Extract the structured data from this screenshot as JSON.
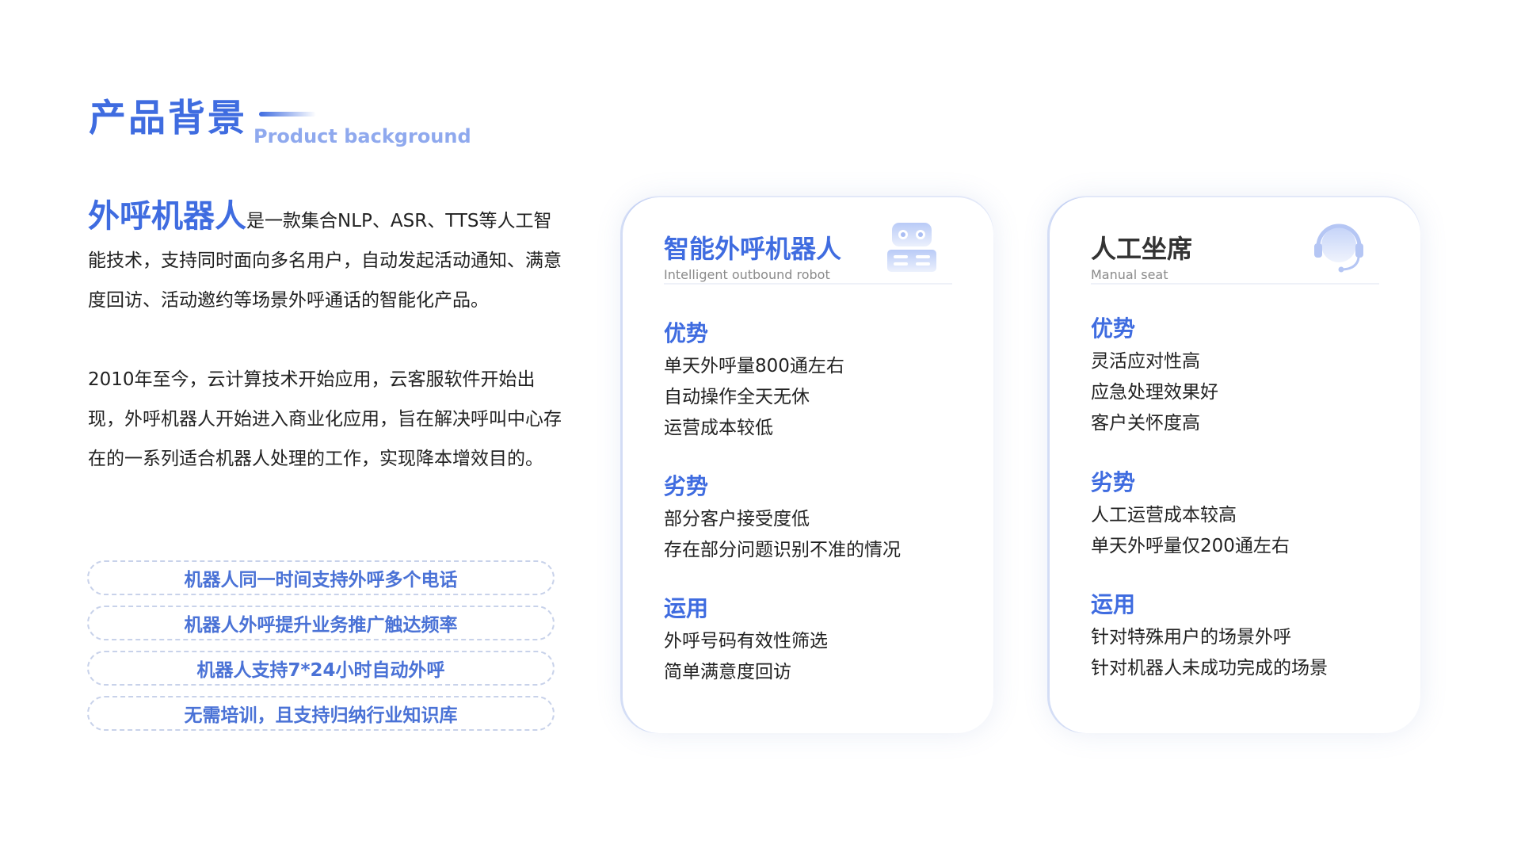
{
  "header": {
    "title_zh": "产品背景",
    "title_en": "Product background"
  },
  "intro": {
    "highlight": "外呼机器人",
    "paragraph1_rest": "是一款集合NLP、ASR、TTS等人工智能技术，支持同时面向多名用户，自动发起活动通知、满意度回访、活动邀约等场景外呼通话的智能化产品。",
    "paragraph2": "2010年至今，云计算技术开始应用，云客服软件开始出现，外呼机器人开始进入商业化应用，旨在解决呼叫中心存在的一系列适合机器人处理的工作，实现降本增效目的。"
  },
  "pills": [
    "机器人同一时间支持外呼多个电话",
    "机器人外呼提升业务推广触达频率",
    "机器人支持7*24小时自动外呼",
    "无需培训，且支持归纳行业知识库"
  ],
  "card_robot": {
    "title": "智能外呼机器人",
    "subtitle": "Intelligent outbound robot",
    "icon": "robot-icon",
    "advantages_title": "优势",
    "advantages": [
      "单天外呼量800通左右",
      "自动操作全天无休",
      "运营成本较低"
    ],
    "disadvantages_title": "劣势",
    "disadvantages": [
      "部分客户接受度低",
      "存在部分问题识别不准的情况"
    ],
    "usage_title": "运用",
    "usage": [
      "外呼号码有效性筛选",
      "简单满意度回访"
    ]
  },
  "card_manual": {
    "title": "人工坐席",
    "subtitle": "Manual seat",
    "icon": "headset-agent-icon",
    "advantages_title": "优势",
    "advantages": [
      "灵活应对性高",
      "应急处理效果好",
      "客户关怀度高"
    ],
    "disadvantages_title": "劣势",
    "disadvantages": [
      "人工运营成本较高",
      "单天外呼量仅200通左右"
    ],
    "usage_title": "运用",
    "usage": [
      "针对特殊用户的场景外呼",
      "针对机器人未成功完成的场景"
    ]
  },
  "colors": {
    "accent": "#3f6ce0",
    "accent_light": "#8fa9ee",
    "pill_text": "#4a72d6",
    "body_text": "#222222"
  }
}
